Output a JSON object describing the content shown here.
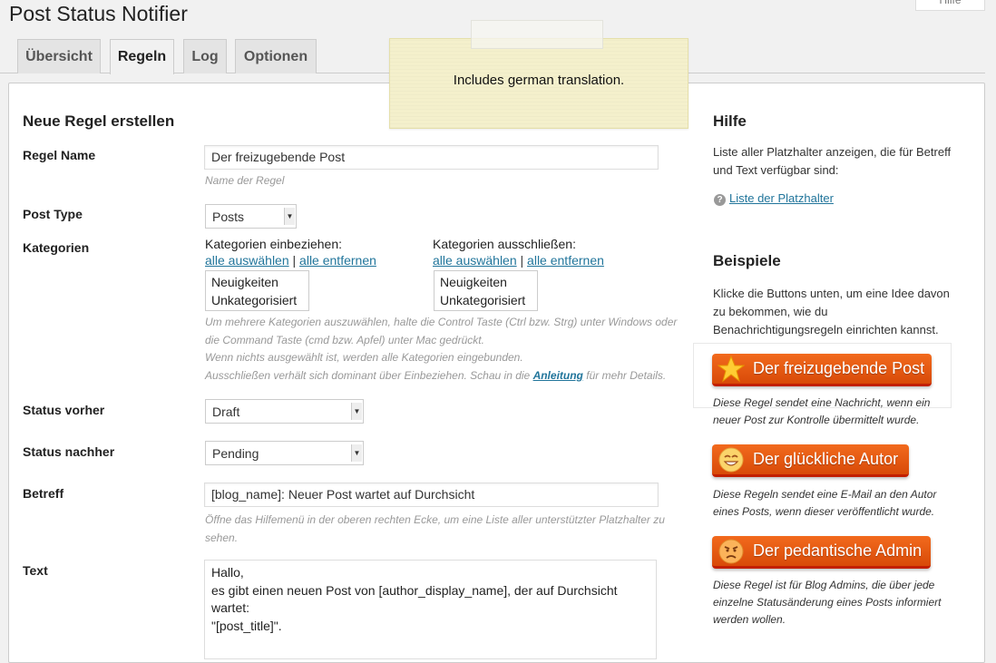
{
  "page": {
    "title": "Post Status Notifier",
    "help_tab": "Hilfe"
  },
  "tabs": [
    {
      "label": "Übersicht",
      "active": false
    },
    {
      "label": "Regeln",
      "active": true
    },
    {
      "label": "Log",
      "active": false
    },
    {
      "label": "Optionen",
      "active": false
    }
  ],
  "note": {
    "text": "Includes german translation."
  },
  "form": {
    "heading": "Neue Regel erstellen",
    "rule_name": {
      "label": "Regel Name",
      "value": "Der freizugebende Post",
      "desc": "Name der Regel"
    },
    "post_type": {
      "label": "Post Type",
      "value": "Posts"
    },
    "categories": {
      "label": "Kategorien",
      "include_label": "Kategorien einbeziehen:",
      "exclude_label": "Kategorien ausschließen:",
      "select_all": "alle auswählen",
      "separator": "|",
      "remove_all": "alle entfernen",
      "options": [
        "Neuigkeiten",
        "Unkategorisiert"
      ],
      "desc_line1": "Um mehrere Kategorien auszuwählen, halte die Control Taste (Ctrl bzw. Strg) unter Windows oder",
      "desc_line2": "die Command Taste (cmd bzw. Apfel) unter Mac gedrückt.",
      "desc_line3": "Wenn nichts ausgewählt ist, werden alle Kategorien eingebunden.",
      "desc_line4_pre": "Ausschließen verhält sich dominant über Einbeziehen. Schau in die",
      "desc_link": "Anleitung",
      "desc_line4_post": "für mehr Details."
    },
    "status_before": {
      "label": "Status vorher",
      "value": "Draft"
    },
    "status_after": {
      "label": "Status nachher",
      "value": "Pending"
    },
    "subject": {
      "label": "Betreff",
      "value": "[blog_name]: Neuer Post wartet auf Durchsicht",
      "desc_line1": "Öffne das Hilfemenü in der oberen rechten Ecke, um eine Liste aller unterstützter Platzhalter zu",
      "desc_line2": "sehen."
    },
    "text": {
      "label": "Text",
      "lines": [
        "Hallo,",
        "es gibt einen neuen Post von [author_display_name], der auf Durchsicht",
        "wartet:",
        "\"[post_title]\"."
      ]
    }
  },
  "sidebar": {
    "help_heading": "Hilfe",
    "help_text_1": "Liste aller Platzhalter anzeigen, die für Betreff",
    "help_text_2": "und Text verfügbar sind:",
    "placeholder_link": "Liste der Platzhalter",
    "examples_heading": "Beispiele",
    "examples_text": [
      "Klicke die Buttons unten, um eine Idee davon",
      "zu bekommen, wie du",
      "Benachrichtigungsregeln einrichten kannst."
    ],
    "examples": [
      {
        "label": "Der freizugebende Post",
        "icon": "star-icon",
        "desc": [
          "Diese Regel sendet eine Nachricht, wenn ein",
          "neuer Post zur Kontrolle übermittelt wurde."
        ]
      },
      {
        "label": "Der glückliche Autor",
        "icon": "happy-face-icon",
        "desc": [
          "Diese Regeln sendet eine E-Mail an den Autor",
          "eines Posts, wenn dieser veröffentlicht wurde."
        ]
      },
      {
        "label": "Der pedantische Admin",
        "icon": "grumpy-face-icon",
        "desc": [
          "Diese Regel ist für Blog Admins, die über jede",
          "einzelne Statusänderung eines Posts informiert",
          "werden wollen."
        ]
      }
    ]
  },
  "colors": {
    "accent_link": "#21759b",
    "button_orange": "#e85a12",
    "note_yellow": "#f4f0cc"
  }
}
